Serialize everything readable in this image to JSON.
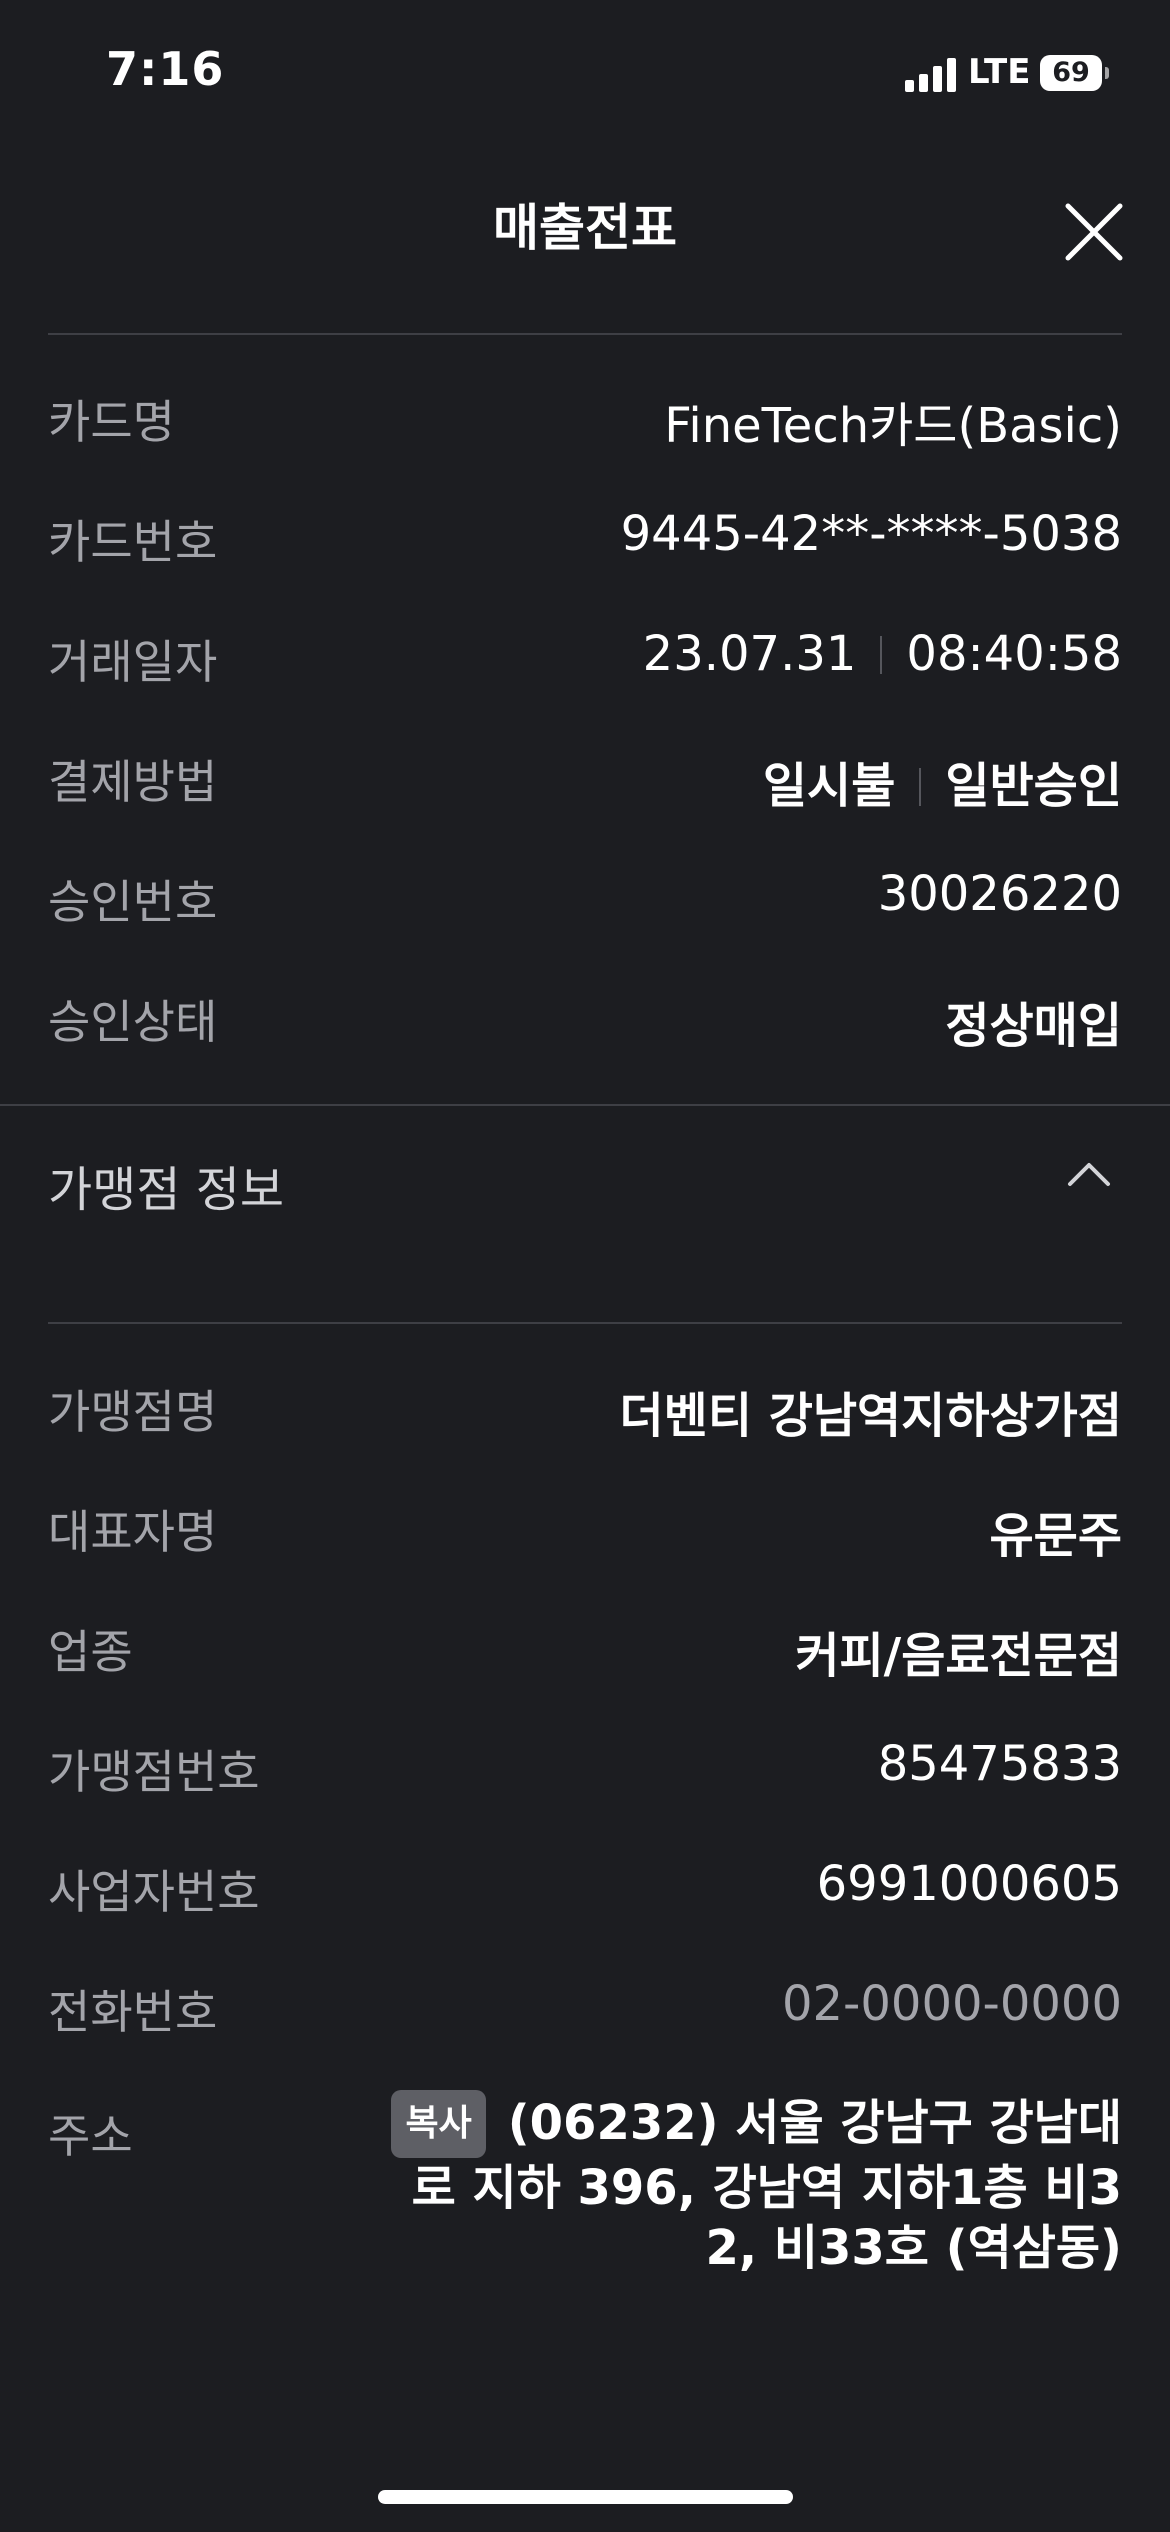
{
  "status_bar": {
    "time": "7:16",
    "network": "LTE",
    "battery": "69"
  },
  "header": {
    "title": "매출전표"
  },
  "transaction": {
    "rows": [
      {
        "label": "카드명",
        "value": "FineTech카드(Basic)"
      },
      {
        "label": "카드번호",
        "value": "9445-42**-****-5038"
      },
      {
        "label": "거래일자",
        "value_a": "23.07.31",
        "value_b": "08:40:58"
      },
      {
        "label": "결제방법",
        "value_a": "일시불",
        "value_b": "일반승인"
      },
      {
        "label": "승인번호",
        "value": "30026220"
      },
      {
        "label": "승인상태",
        "value": "정상매입"
      }
    ]
  },
  "merchant": {
    "section_title": "가맹점 정보",
    "rows": [
      {
        "label": "가맹점명",
        "value": "더벤티 강남역지하상가점"
      },
      {
        "label": "대표자명",
        "value": "유문주"
      },
      {
        "label": "업종",
        "value": "커피/음료전문점"
      },
      {
        "label": "가맹점번호",
        "value": "85475833"
      },
      {
        "label": "사업자번호",
        "value": "6991000605"
      },
      {
        "label": "전화번호",
        "value": "02-0000-0000"
      }
    ],
    "address_label": "주소",
    "copy_label": "복사",
    "address": "(06232) 서울 강남구 강남대로 지하 396, 강남역 지하1층 비32, 비33호 (역삼동)"
  }
}
